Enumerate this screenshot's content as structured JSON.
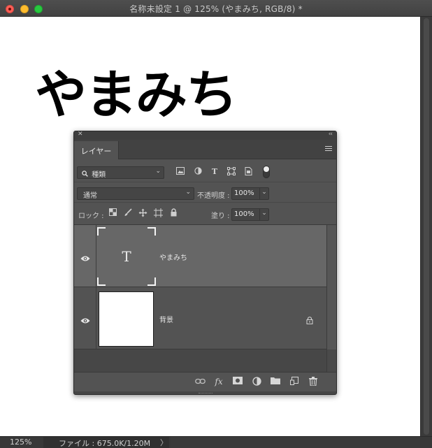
{
  "window": {
    "title": "名称未設定 1 @ 125% (やまみち, RGB/8) *"
  },
  "canvas": {
    "text": "やまみち"
  },
  "status": {
    "zoom": "125%",
    "file_info": "ファイル : 675.0K/1.20M",
    "chevron": "〉"
  },
  "panel": {
    "close_glyph": "✕",
    "collapse_glyph": "‹‹",
    "tab_label": "レイヤー",
    "filter": {
      "selected": "種類",
      "chevron": "⌄"
    },
    "blend": {
      "mode": "通常",
      "chevron": "⌄",
      "opacity_label": "不透明度 :",
      "opacity_value": "100%"
    },
    "lock": {
      "label": "ロック :",
      "fill_label": "塗り :",
      "fill_value": "100%"
    },
    "layers": [
      {
        "name": "やまみち",
        "thumb_glyph": "T",
        "selected": true
      },
      {
        "name": "背景",
        "locked": true
      }
    ],
    "bottom_icons": [
      "link-icon",
      "fx-icon",
      "mask-icon",
      "adjustment-icon",
      "folder-icon",
      "new-layer-icon",
      "trash-icon"
    ],
    "fx_label": "fx"
  },
  "colors": {
    "panel_bg": "#535353",
    "selected_layer": "#676767",
    "title_bar": "#474747"
  }
}
